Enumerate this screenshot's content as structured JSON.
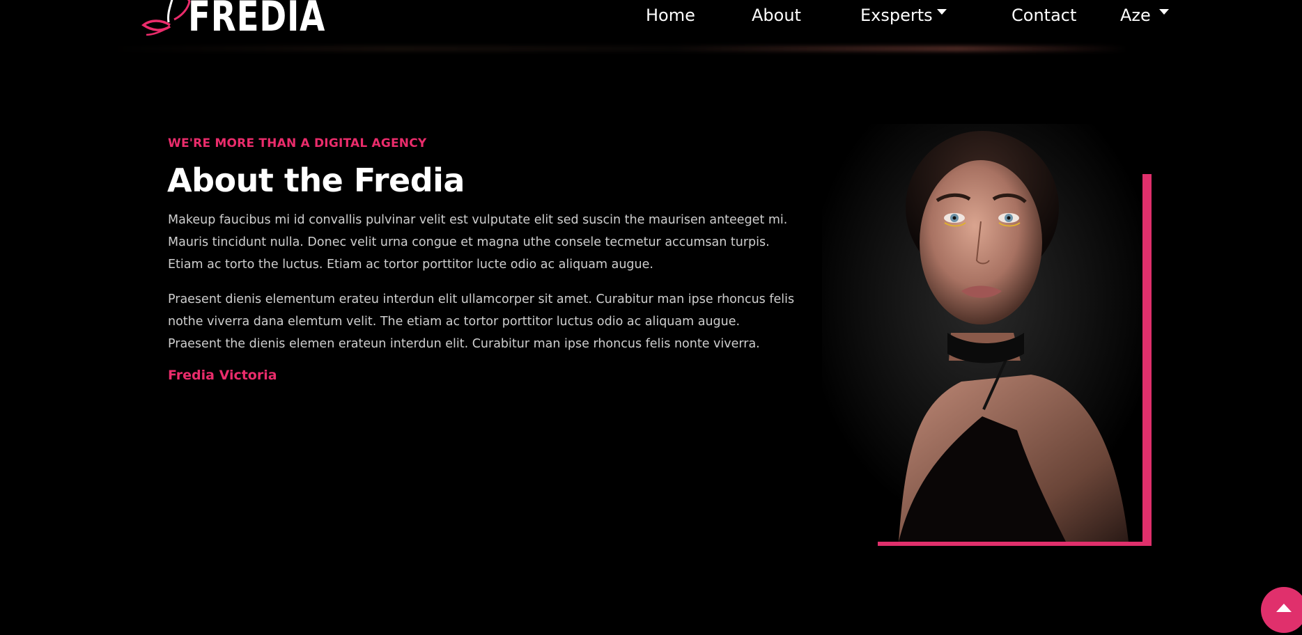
{
  "brand": {
    "name": "FREDIA",
    "accent": "#ea2c6b",
    "frame_color": "#e0306c"
  },
  "nav": {
    "items": [
      {
        "label": "Home",
        "dropdown": false
      },
      {
        "label": "About",
        "dropdown": false
      },
      {
        "label": "Exsperts",
        "dropdown": true
      },
      {
        "label": "Contact",
        "dropdown": false
      }
    ],
    "language": {
      "label": "Aze",
      "dropdown": true
    }
  },
  "about": {
    "tagline": "WE'RE MORE THAN A DIGITAL AGENCY",
    "title": "About the Fredia",
    "paragraph1": "Makeup faucibus mi id convallis pulvinar velit est vulputate elit sed suscin the maurisen anteeget mi. Mauris tincidunt nulla. Donec velit urna congue et magna uthe consele tecmetur accumsan turpis. Etiam ac torto the luctus. Etiam ac tortor porttitor lucte odio ac aliquam augue.",
    "paragraph2": "Praesent dienis elementum erateu interdun elit ullamcorper sit amet. Curabitur man ipse rhoncus felis nothe viverra dana elemtum velit. The etiam ac tortor porttitor luctus odio ac aliquam augue. Praesent the dienis elemen erateun interdun elit. Curabitur man ipse rhoncus felis nonte viverra.",
    "signature": "Fredia Victoria"
  },
  "icons": {
    "logo": "butterfly-logo-icon",
    "scroll_top": "arrow-up-icon",
    "dropdown": "caret-down-icon"
  }
}
